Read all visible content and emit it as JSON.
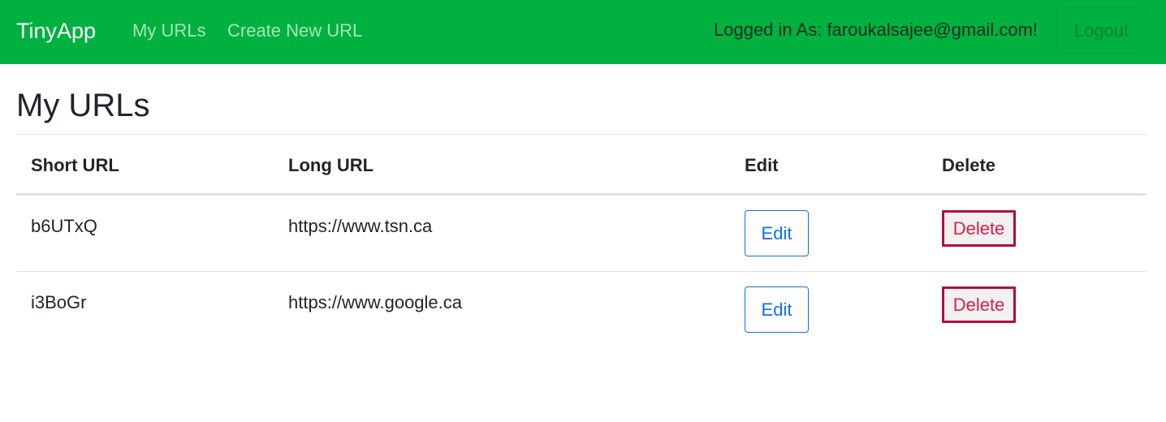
{
  "navbar": {
    "brand": "TinyApp",
    "links": [
      {
        "label": "My URLs"
      },
      {
        "label": "Create New URL"
      }
    ],
    "login_status": "Logged in As: faroukalsajee@gmail.com!",
    "logout_label": "Logout",
    "colors": {
      "background": "#00b140"
    }
  },
  "main": {
    "title": "My URLs",
    "table": {
      "headers": [
        "Short URL",
        "Long URL",
        "Edit",
        "Delete"
      ],
      "rows": [
        {
          "short_url": "b6UTxQ",
          "long_url": "https://www.tsn.ca",
          "edit_label": "Edit",
          "delete_label": "Delete"
        },
        {
          "short_url": "i3BoGr",
          "long_url": "https://www.google.ca",
          "edit_label": "Edit",
          "delete_label": "Delete"
        }
      ]
    },
    "colors": {
      "edit_button": "#0d6efd",
      "delete_button": "#dc1f47"
    }
  }
}
